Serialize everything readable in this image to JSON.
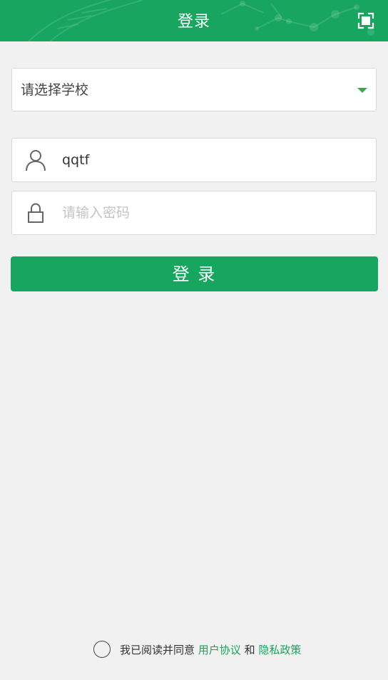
{
  "header": {
    "title": "登录",
    "scan_icon": "scan-icon",
    "background_color": "#18a560"
  },
  "form": {
    "school_select": {
      "placeholder": "请选择学校",
      "arrow_icon": "caret-down-icon",
      "arrow_color": "#3aa84a"
    },
    "username": {
      "value": "qqtf",
      "icon": "user-icon"
    },
    "password": {
      "placeholder": "请输入密码",
      "icon": "lock-icon"
    },
    "login_button": {
      "label": "登 录",
      "color": "#18a560"
    }
  },
  "agreement": {
    "prefix": "我已阅读并同意",
    "user_agreement": "用户协议",
    "conjunction": "和",
    "privacy_policy": "隐私政策",
    "checked": false,
    "link_color": "#18a560"
  }
}
